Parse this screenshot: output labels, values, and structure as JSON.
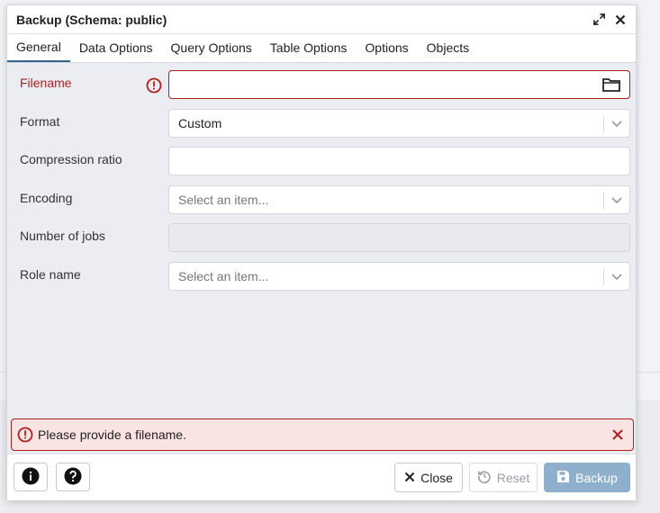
{
  "dialog": {
    "title": "Backup (Schema: public)"
  },
  "tabs": [
    {
      "label": "General",
      "active": true
    },
    {
      "label": "Data Options",
      "active": false
    },
    {
      "label": "Query Options",
      "active": false
    },
    {
      "label": "Table Options",
      "active": false
    },
    {
      "label": "Options",
      "active": false
    },
    {
      "label": "Objects",
      "active": false
    }
  ],
  "form": {
    "filename": {
      "label": "Filename",
      "value": ""
    },
    "format": {
      "label": "Format",
      "value": "Custom"
    },
    "compression": {
      "label": "Compression ratio",
      "value": ""
    },
    "encoding": {
      "label": "Encoding",
      "placeholder": "Select an item..."
    },
    "jobs": {
      "label": "Number of jobs",
      "value": ""
    },
    "role": {
      "label": "Role name",
      "placeholder": "Select an item..."
    }
  },
  "alert": {
    "message": "Please provide a filename."
  },
  "footer": {
    "close_label": "Close",
    "reset_label": "Reset",
    "backup_label": "Backup"
  },
  "colors": {
    "error": "#b21e1e",
    "accent": "#326690",
    "primary_disabled": "#8fb0cd"
  },
  "icons": {
    "expand": "expand-icon",
    "close": "close-icon",
    "error": "error-circle-icon",
    "folder": "folder-icon",
    "chevron": "chevron-down-icon",
    "info": "info-icon",
    "help": "help-icon",
    "reset": "reset-icon",
    "save": "save-icon"
  }
}
